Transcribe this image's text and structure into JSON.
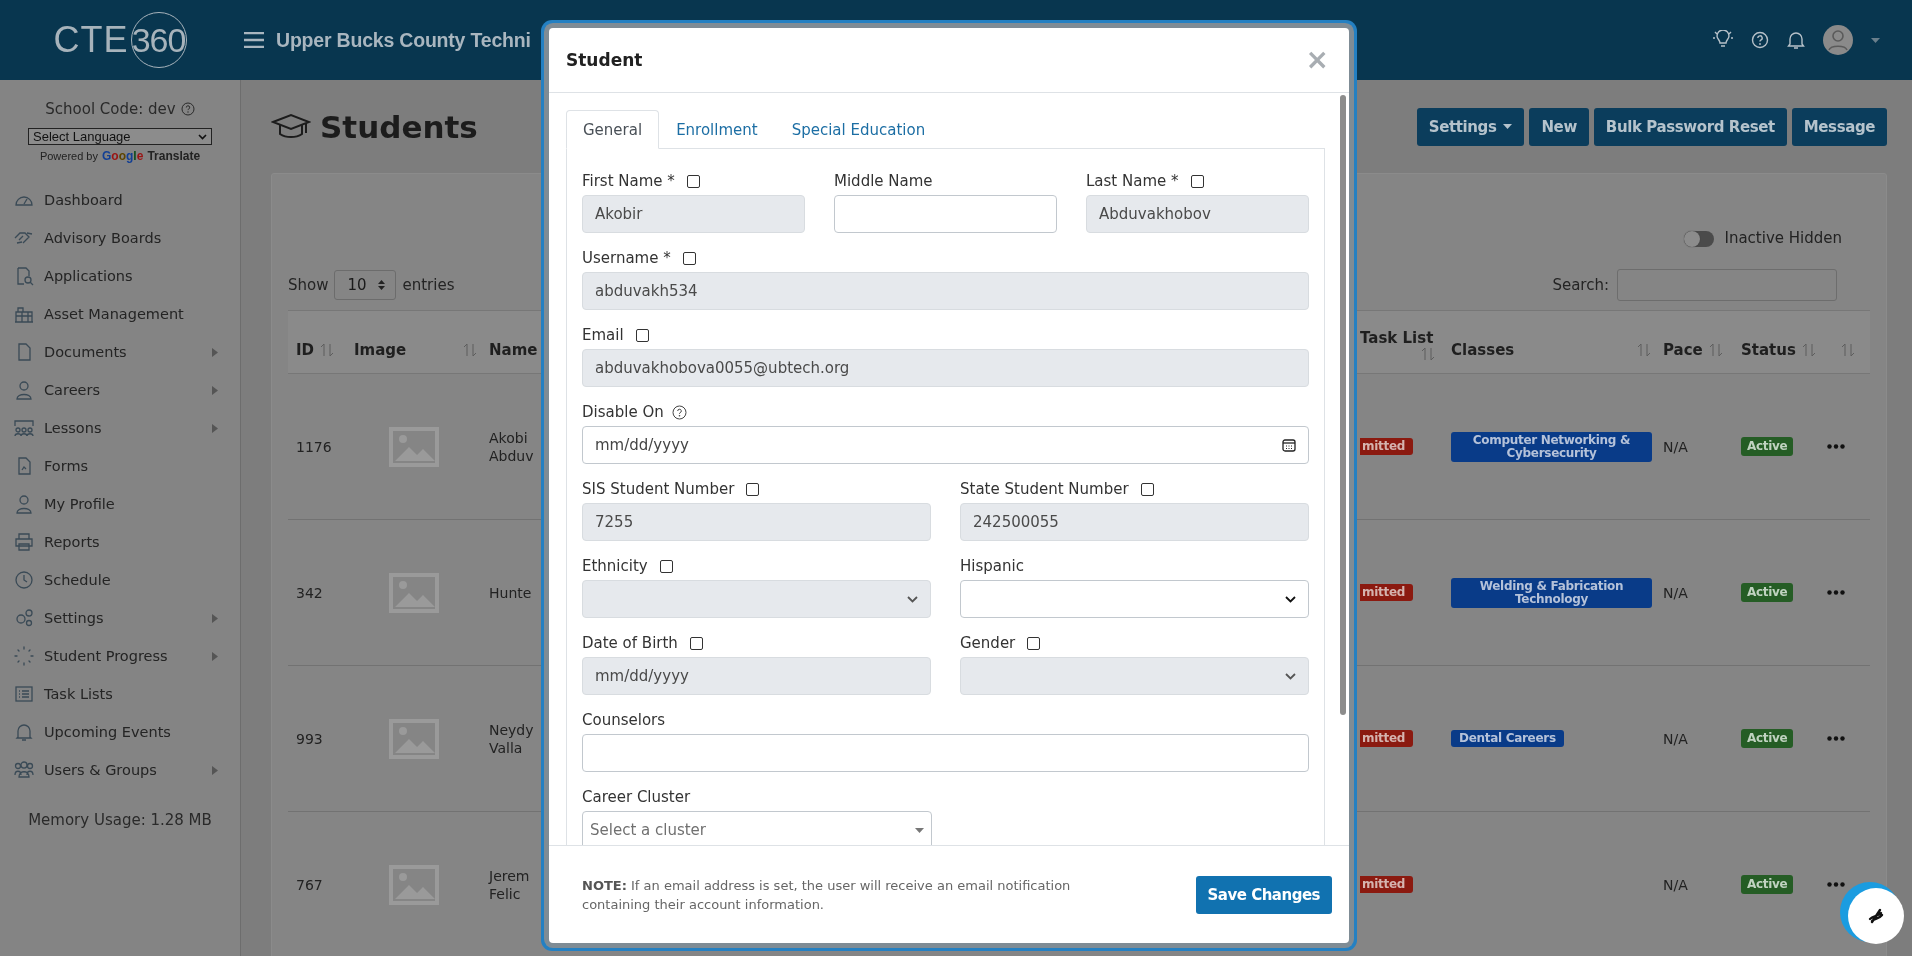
{
  "header": {
    "logo": {
      "text": "CTE",
      "circled": "360"
    },
    "title": "Upper Bucks County Techni"
  },
  "sidebar": {
    "school_code": "School Code: dev",
    "language": "Select Language",
    "powered": {
      "prefix": "Powered by",
      "brand": "Google",
      "suffix": "Translate"
    },
    "items": [
      {
        "label": "Dashboard",
        "expandable": false
      },
      {
        "label": "Advisory Boards",
        "expandable": false
      },
      {
        "label": "Applications",
        "expandable": false
      },
      {
        "label": "Asset Management",
        "expandable": false
      },
      {
        "label": "Documents",
        "expandable": true
      },
      {
        "label": "Careers",
        "expandable": true
      },
      {
        "label": "Lessons",
        "expandable": true
      },
      {
        "label": "Forms",
        "expandable": false
      },
      {
        "label": "My Profile",
        "expandable": false
      },
      {
        "label": "Reports",
        "expandable": false
      },
      {
        "label": "Schedule",
        "expandable": false
      },
      {
        "label": "Settings",
        "expandable": true
      },
      {
        "label": "Student Progress",
        "expandable": true
      },
      {
        "label": "Task Lists",
        "expandable": false
      },
      {
        "label": "Upcoming Events",
        "expandable": false
      },
      {
        "label": "Users & Groups",
        "expandable": true
      }
    ],
    "memory": "Memory Usage: 1.28 MB"
  },
  "page": {
    "title": "Students",
    "buttons": [
      {
        "label": "Settings",
        "kind": "dropdown"
      },
      {
        "label": "New",
        "kind": "plain"
      },
      {
        "label": "Bulk Password Reset",
        "kind": "plain"
      },
      {
        "label": "Message",
        "kind": "plain"
      }
    ],
    "toggle": {
      "label": "Inactive Hidden",
      "on": false
    },
    "show": {
      "prefix": "Show",
      "value": "10",
      "suffix": "entries"
    },
    "search": {
      "label": "Search:"
    },
    "table": {
      "columns": [
        "ID",
        "Image",
        "Name",
        "Task List",
        "Classes",
        "Pace",
        "Status",
        ""
      ],
      "rows": [
        {
          "id": "1176",
          "name": [
            "Akobi",
            "Abduv"
          ],
          "task": "mitted",
          "classes": "Computer Networking & Cybersecurity",
          "pace": "N/A",
          "status": "Active"
        },
        {
          "id": "342",
          "name": [
            "Hunte"
          ],
          "task": "mitted",
          "classes": "Welding & Fabrication Technology",
          "pace": "N/A",
          "status": "Active"
        },
        {
          "id": "993",
          "name": [
            "Neydy",
            "Valla"
          ],
          "task": "mitted",
          "classes": "Dental Careers",
          "pace": "N/A",
          "status": "Active"
        },
        {
          "id": "767",
          "name": [
            "Jerem",
            "Felic"
          ],
          "task": "mitted",
          "pace": "N/A",
          "status": "Active"
        }
      ]
    }
  },
  "modal": {
    "title": "Student",
    "close": "×",
    "tabs": [
      {
        "label": "General",
        "selected": true
      },
      {
        "label": "Enrollment",
        "selected": false
      },
      {
        "label": "Special Education",
        "selected": false
      }
    ],
    "rows": [
      [
        {
          "label": "First Name *",
          "kind": "text",
          "value": "Akobir",
          "disabled": true,
          "checked": false
        },
        {
          "label": "Middle Name",
          "kind": "text",
          "disabled": false
        },
        {
          "label": "Last Name *",
          "kind": "text",
          "value": "Abduvakhobov",
          "disabled": true,
          "checked": false
        }
      ],
      [
        {
          "label": "Username *",
          "kind": "text",
          "value": "abduvakh534",
          "disabled": true,
          "checked": false
        }
      ],
      [
        {
          "label": "Email",
          "kind": "text",
          "value": "abduvakhobova0055@ubtech.org",
          "disabled": true,
          "checked": false
        }
      ],
      [
        {
          "label": "Disable On",
          "kind": "date",
          "value": "mm/dd/yyyy",
          "disabled": false,
          "help": true
        }
      ],
      [
        {
          "label": "SIS Student Number",
          "kind": "text",
          "value": "7255",
          "disabled": true,
          "checked": false
        },
        {
          "label": "State Student Number",
          "kind": "text",
          "value": "242500055",
          "disabled": true,
          "checked": false
        }
      ],
      [
        {
          "label": "Ethnicity",
          "kind": "select",
          "disabled": true,
          "checked": false
        },
        {
          "label": "Hispanic",
          "kind": "select",
          "disabled": false
        }
      ],
      [
        {
          "label": "Date of Birth",
          "kind": "date",
          "value": "mm/dd/yyyy",
          "disabled": true,
          "checked": false
        },
        {
          "label": "Gender",
          "kind": "select",
          "disabled": true,
          "checked": false
        }
      ],
      [
        {
          "label": "Counselors",
          "kind": "text",
          "disabled": false
        }
      ],
      [
        {
          "label": "Career Cluster",
          "kind": "combo",
          "placeholder": "Select a cluster",
          "disabled": false
        }
      ]
    ],
    "note": "**NOTE:** If an email address is set, the user will receive an email notification containing their account information.",
    "save": "Save Changes"
  }
}
